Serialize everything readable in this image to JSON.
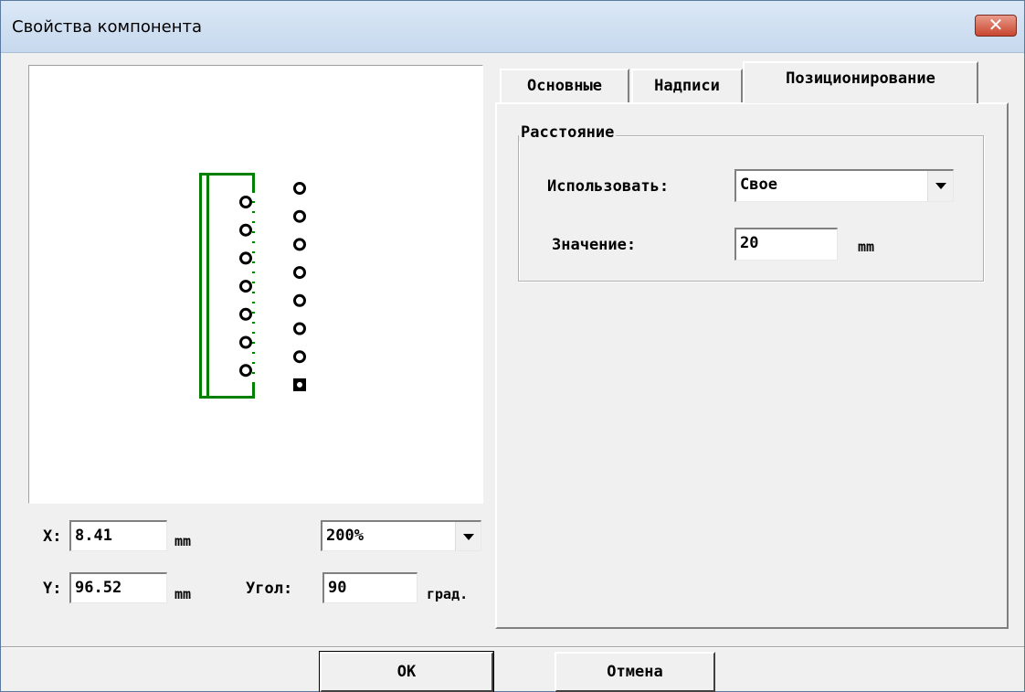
{
  "window": {
    "title": "Свойства компонента",
    "close_glyph": "✕"
  },
  "preview": {
    "x_label": "X:",
    "x_value": "8.41",
    "x_unit": "mm",
    "y_label": "Y:",
    "y_value": "96.52",
    "y_unit": "mm",
    "zoom_value": "200%",
    "angle_label": "Угол:",
    "angle_value": "90",
    "angle_unit": "град.",
    "colors": {
      "outline": "#008000",
      "pad": "#000000"
    },
    "pins_per_row": 7
  },
  "tabs": [
    {
      "label": "Основные",
      "active": false
    },
    {
      "label": "Надписи",
      "active": false
    },
    {
      "label": "Позиционирование",
      "active": true
    }
  ],
  "positioning": {
    "group_label": "Расстояние",
    "use_label": "Использовать:",
    "use_value": "Свое",
    "value_label": "Значение:",
    "value_value": "20",
    "value_unit": "mm"
  },
  "buttons": {
    "ok": "OK",
    "cancel": "Отмена"
  }
}
